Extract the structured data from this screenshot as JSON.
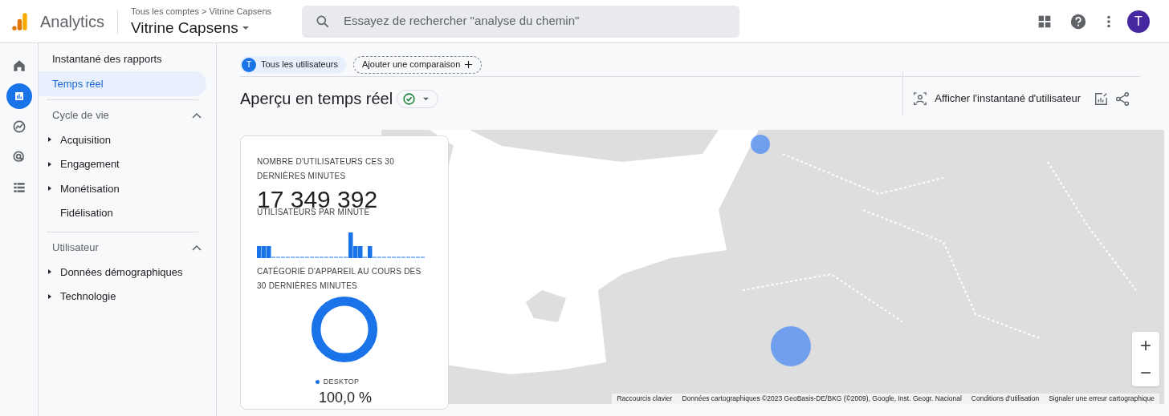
{
  "header": {
    "product": "Analytics",
    "breadcrumb": "Tous les comptes > Vitrine Capsens",
    "property": "Vitrine Capsens",
    "search_placeholder": "Essayez de rechercher \"analyse du chemin\"",
    "avatar": "T"
  },
  "rail": [
    {
      "selected": false
    },
    {
      "selected": true
    },
    {
      "selected": false
    },
    {
      "selected": false
    },
    {
      "selected": false
    }
  ],
  "nav": [
    {
      "kind": "link",
      "label": "Instantané des rapports",
      "selected": false
    },
    {
      "kind": "link",
      "label": "Temps réel",
      "selected": true
    },
    {
      "kind": "section",
      "label": "Cycle de vie",
      "expanded": true,
      "children": [
        {
          "label": "Acquisition",
          "has_children": true
        },
        {
          "label": "Engagement",
          "has_children": true
        },
        {
          "label": "Monétisation",
          "has_children": true
        },
        {
          "label": "Fidélisation",
          "has_children": false
        }
      ]
    },
    {
      "kind": "section",
      "label": "Utilisateur",
      "expanded": true,
      "children": [
        {
          "label": "Données démographiques",
          "has_children": true
        },
        {
          "label": "Technologie",
          "has_children": true
        }
      ]
    }
  ],
  "comparison": {
    "chip_initial": "T",
    "chip": "Tous les utilisateurs",
    "add": "Ajouter une comparaison"
  },
  "title": "Aperçu en temps réel",
  "actions": {
    "snapshot": "Afficher l'instantané d'utilisateur"
  },
  "card": {
    "users_label": "NOMBRE D'UTILISATEURS CES 30 DERNIÈRES MINUTES",
    "users_value": "17 349 392",
    "per_minute_label": "UTILISATEURS PAR MINUTE",
    "device_label": "CATÉGORIE D'APPAREIL AU COURS DES 30 DERNIÈRES MINUTES",
    "legend": "DESKTOP",
    "share": "100,0 %"
  },
  "map": {
    "kind": "picture",
    "zoom_in": "+",
    "zoom_out": "−",
    "attribution": [
      "Raccourcis clavier",
      "Données cartographiques ©2023 GeoBasis-DE/BKG (©2009), Google, Inst. Geogr. Nacional",
      "Conditions d'utilisation",
      "Signaler une erreur cartographique"
    ]
  }
}
